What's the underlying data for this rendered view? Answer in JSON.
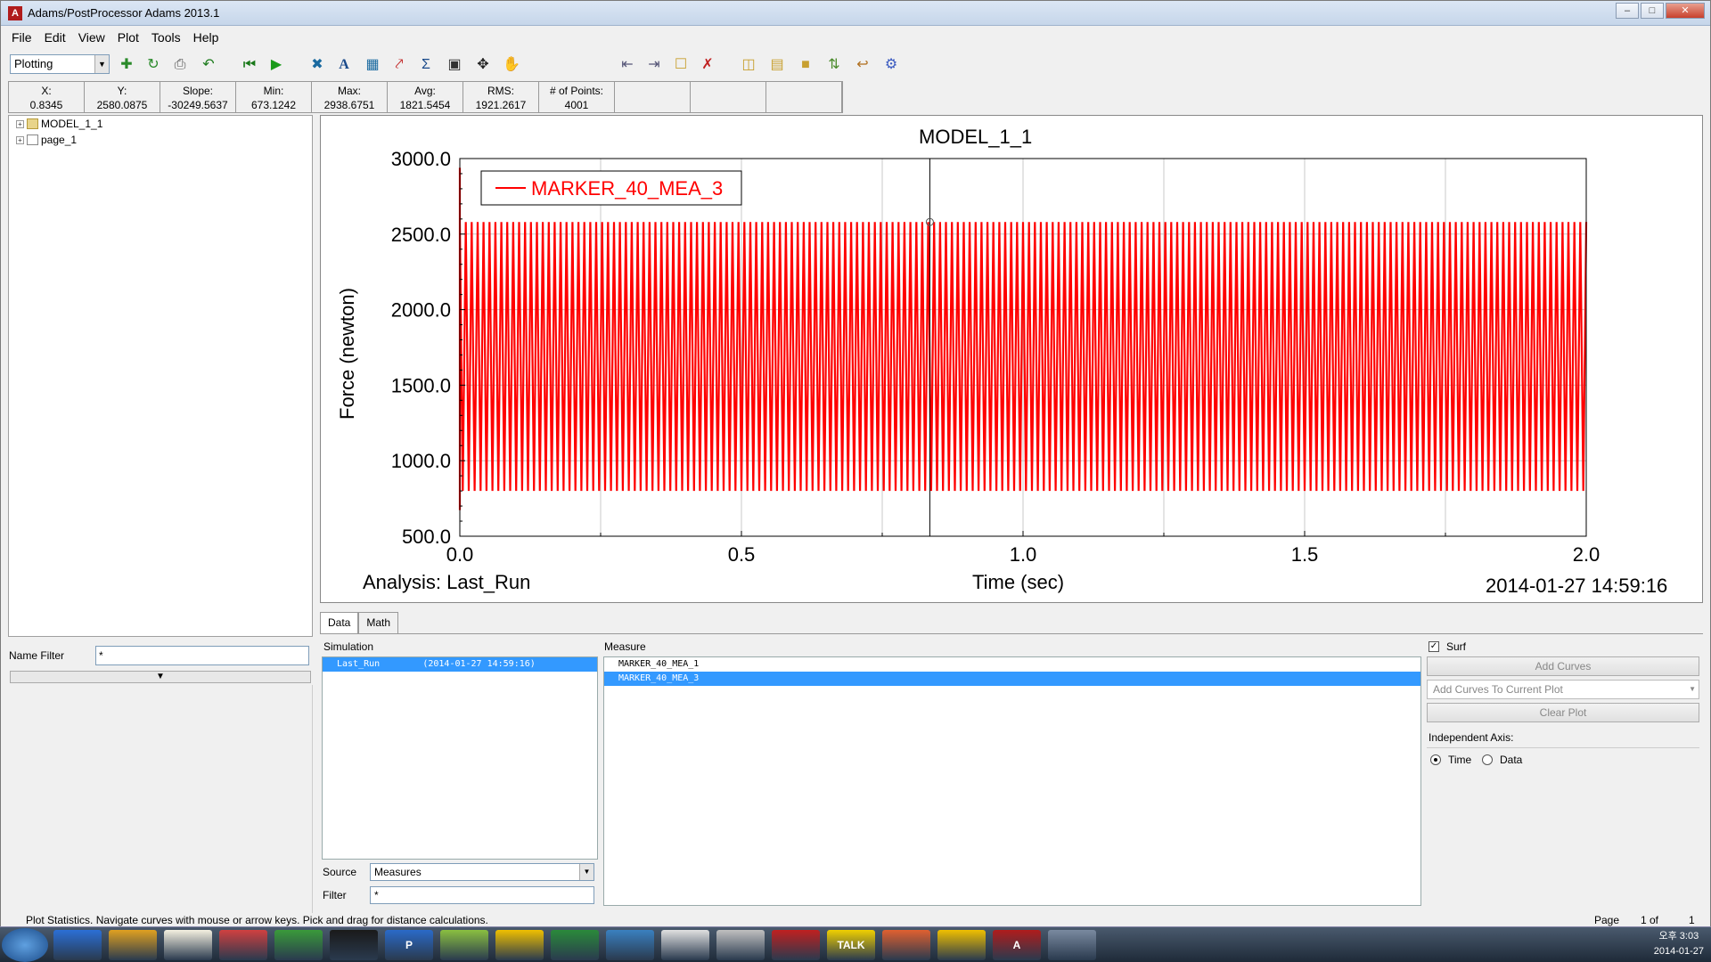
{
  "window": {
    "title": "Adams/PostProcessor Adams 2013.1",
    "app_icon": "A"
  },
  "menu": [
    "File",
    "Edit",
    "View",
    "Plot",
    "Tools",
    "Help"
  ],
  "toolbar": {
    "mode": "Plotting"
  },
  "stats": [
    {
      "label": "X:",
      "value": "0.8345"
    },
    {
      "label": "Y:",
      "value": "2580.0875"
    },
    {
      "label": "Slope:",
      "value": "-30249.5637"
    },
    {
      "label": "Min:",
      "value": "673.1242"
    },
    {
      "label": "Max:",
      "value": "2938.6751"
    },
    {
      "label": "Avg:",
      "value": "1821.5454"
    },
    {
      "label": "RMS:",
      "value": "1921.2617"
    },
    {
      "label": "# of Points:",
      "value": "4001"
    },
    {
      "label": "",
      "value": ""
    },
    {
      "label": "",
      "value": ""
    },
    {
      "label": "",
      "value": ""
    }
  ],
  "tree": [
    {
      "label": "MODEL_1_1",
      "icon": "folder-icon"
    },
    {
      "label": "page_1",
      "icon": "page-icon"
    }
  ],
  "name_filter": {
    "label": "Name Filter",
    "value": "*"
  },
  "plot": {
    "title": "MODEL_1_1",
    "analysis_label": "Analysis:  Last_Run",
    "date": "2014-01-27 14:59:16",
    "cursor_x": 0.8345
  },
  "chart_data": {
    "type": "line",
    "title": "MODEL_1_1",
    "xlabel": "Time (sec)",
    "ylabel": "Force (newton)",
    "xlim": [
      0.0,
      2.0
    ],
    "ylim": [
      500.0,
      3000.0
    ],
    "x_ticks": [
      "0.0",
      "0.5",
      "1.0",
      "1.5",
      "2.0"
    ],
    "y_ticks": [
      "3000.0",
      "2500.0",
      "2000.0",
      "1500.0",
      "1000.0",
      "500.0"
    ],
    "grid": true,
    "legend_position": "top-left",
    "series": [
      {
        "name": "MARKER_40_MEA_3",
        "color": "#ff0000",
        "oscillation": {
          "x_start": 0.0,
          "x_end": 2.0,
          "y_min": 800.0,
          "y_max": 2580.0,
          "initial_peak": 2938.6751,
          "initial_min": 673.1242,
          "points": 4001
        }
      }
    ]
  },
  "tabs": [
    "Data",
    "Math"
  ],
  "data_panel": {
    "simulation_label": "Simulation",
    "simulations": [
      {
        "name": "Last_Run",
        "date": "(2014-01-27 14:59:16)",
        "selected": true
      }
    ],
    "measure_label": "Measure",
    "measures": [
      {
        "name": "MARKER_40_MEA_1",
        "selected": false
      },
      {
        "name": "MARKER_40_MEA_3",
        "selected": true
      }
    ],
    "surf_label": "Surf",
    "add_curves": "Add Curves",
    "add_mode": "Add Curves To Current Plot",
    "clear_plot": "Clear Plot",
    "indep_axis_label": "Independent Axis:",
    "time_label": "Time",
    "data_label": "Data",
    "source_label": "Source",
    "source_value": "Measures",
    "filter_label": "Filter",
    "filter_value": "*"
  },
  "status": {
    "text": "Plot Statistics.  Navigate curves with mouse or arrow keys.  Pick and drag for distance calculations.",
    "page_label": "Page",
    "page_value": "1 of",
    "page_total": "1"
  },
  "taskbar": {
    "time": "오후 3:03",
    "date": "2014-01-27",
    "icons": [
      "windows-start-icon",
      "ie-icon",
      "folder-icon",
      "media-icon",
      "app-icon",
      "app-icon",
      "adams-icon",
      "p-icon",
      "app-icon",
      "autocad-icon",
      "excel-icon",
      "app-icon",
      "app-icon",
      "app-icon",
      "record-icon",
      "talk-icon",
      "powerpoint-icon",
      "autocad-icon",
      "adams-postprocessor-icon",
      "app-icon"
    ],
    "labels": [
      "",
      "",
      "",
      "",
      "",
      "",
      "",
      "P",
      "",
      "",
      "",
      "",
      "",
      "",
      "",
      "TALK",
      "",
      "",
      "A",
      ""
    ]
  }
}
